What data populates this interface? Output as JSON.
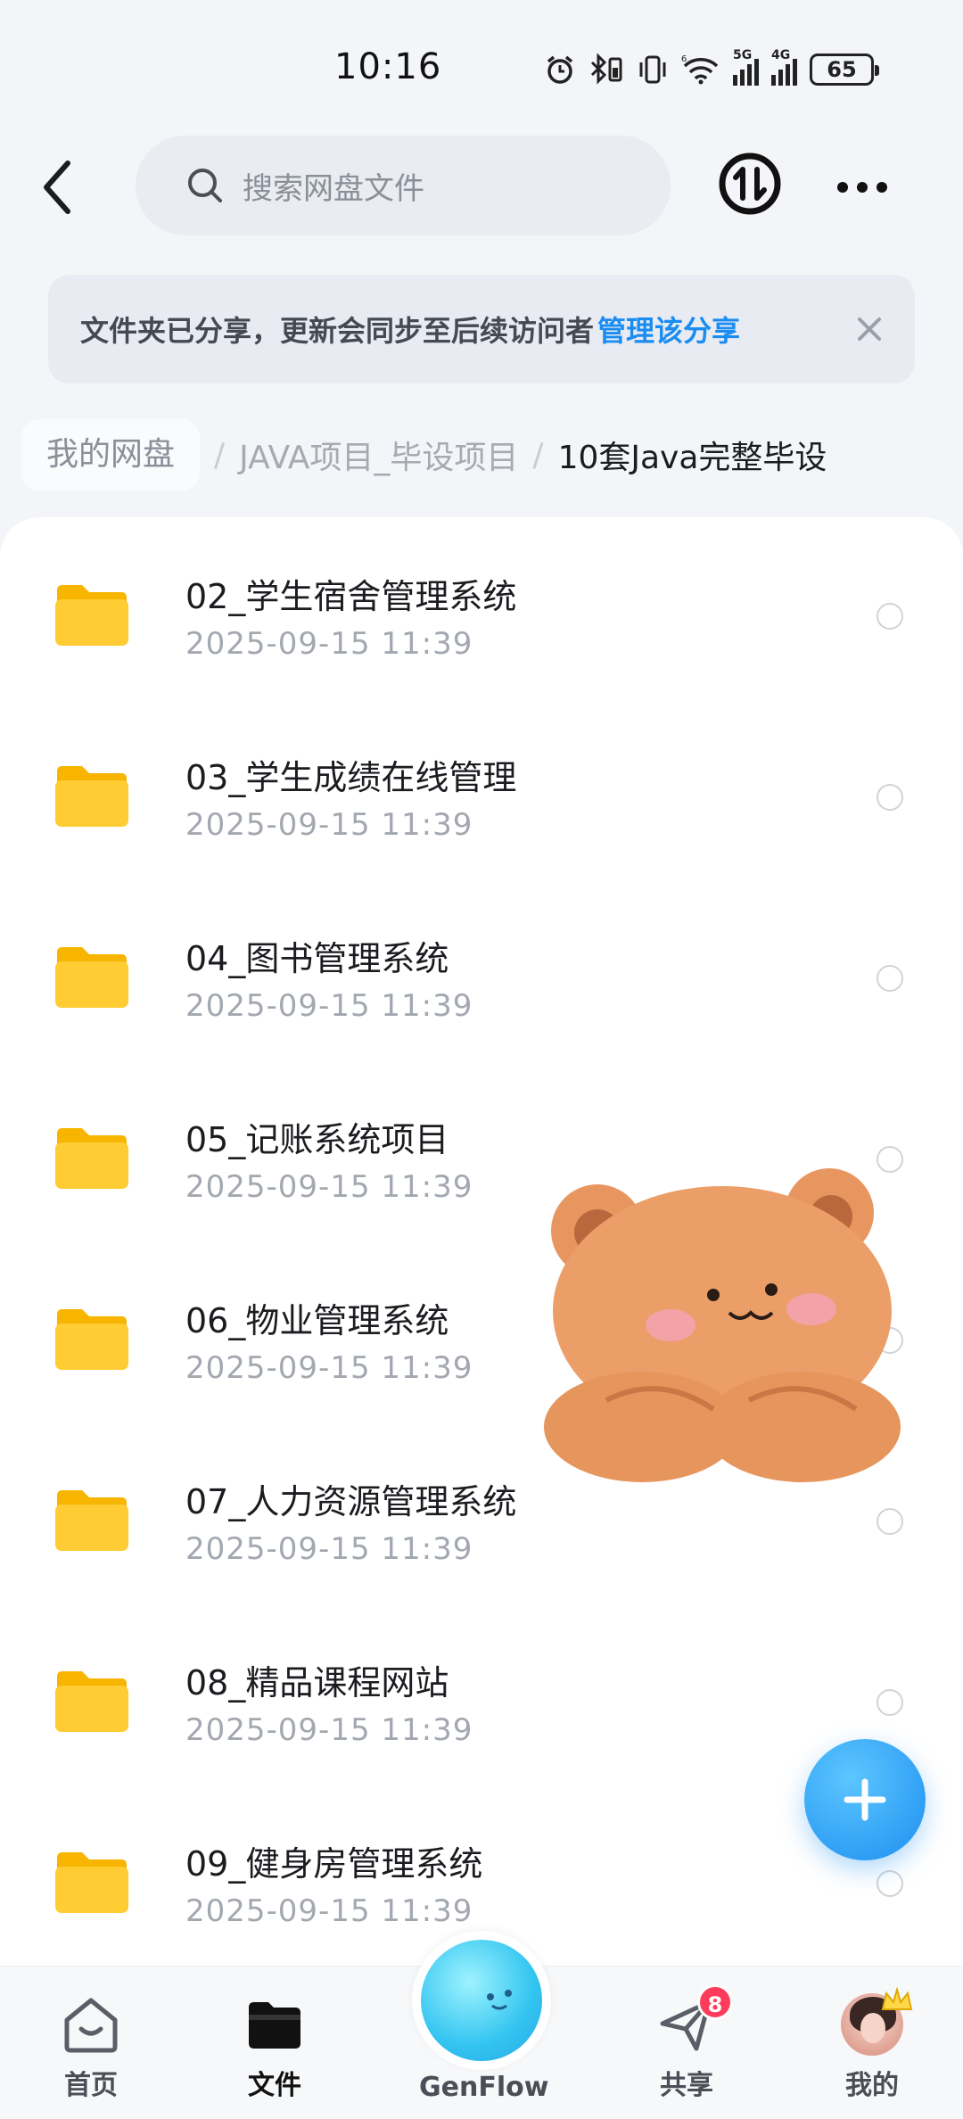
{
  "status_bar": {
    "time": "10:16",
    "network_1": "5G",
    "network_2": "4G",
    "battery": "65"
  },
  "header": {
    "search_placeholder": "搜索网盘文件",
    "icons": [
      "back-icon",
      "search-icon",
      "transfer-icon",
      "more-icon"
    ]
  },
  "banner": {
    "text": "文件夹已分享，更新会同步至后续访问者",
    "link": "管理该分享",
    "accent_color": "#1a8cf2"
  },
  "breadcrumb": {
    "root": "我的网盘",
    "level1": "JAVA项目_毕设项目",
    "current": "10套Java完整毕设"
  },
  "files": [
    {
      "name": "02_学生宿舍管理系统",
      "date": "2025-09-15  11:39"
    },
    {
      "name": "03_学生成绩在线管理",
      "date": "2025-09-15  11:39"
    },
    {
      "name": "04_图书管理系统",
      "date": "2025-09-15  11:39"
    },
    {
      "name": "05_记账系统项目",
      "date": "2025-09-15  11:39"
    },
    {
      "name": "06_物业管理系统",
      "date": "2025-09-15  11:39"
    },
    {
      "name": "07_人力资源管理系统",
      "date": "2025-09-15  11:39"
    },
    {
      "name": "08_精品课程网站",
      "date": "2025-09-15  11:39"
    },
    {
      "name": "09_健身房管理系统",
      "date": "2025-09-15  11:39"
    }
  ],
  "bottom_nav": {
    "home": "首页",
    "files": "文件",
    "genflow": "GenFlow",
    "share": "共享",
    "share_badge": "8",
    "mine": "我的"
  },
  "colors": {
    "folder": "#ffcc33",
    "fab": "#1e8ff0",
    "badge": "#ff3b5b"
  }
}
